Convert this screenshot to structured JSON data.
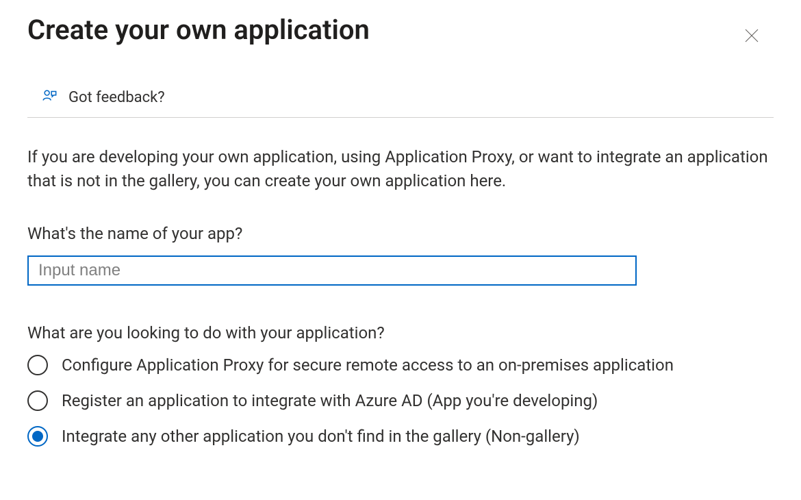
{
  "header": {
    "title": "Create your own application"
  },
  "feedback": {
    "label": "Got feedback?"
  },
  "description": "If you are developing your own application, using Application Proxy, or want to integrate an application that is not in the gallery, you can create your own application here.",
  "name_field": {
    "label": "What's the name of your app?",
    "placeholder": "Input name",
    "value": ""
  },
  "purpose_field": {
    "label": "What are you looking to do with your application?",
    "options": [
      {
        "label": "Configure Application Proxy for secure remote access to an on-premises application",
        "selected": false
      },
      {
        "label": "Register an application to integrate with Azure AD (App you're developing)",
        "selected": false
      },
      {
        "label": "Integrate any other application you don't find in the gallery (Non-gallery)",
        "selected": true
      }
    ]
  }
}
